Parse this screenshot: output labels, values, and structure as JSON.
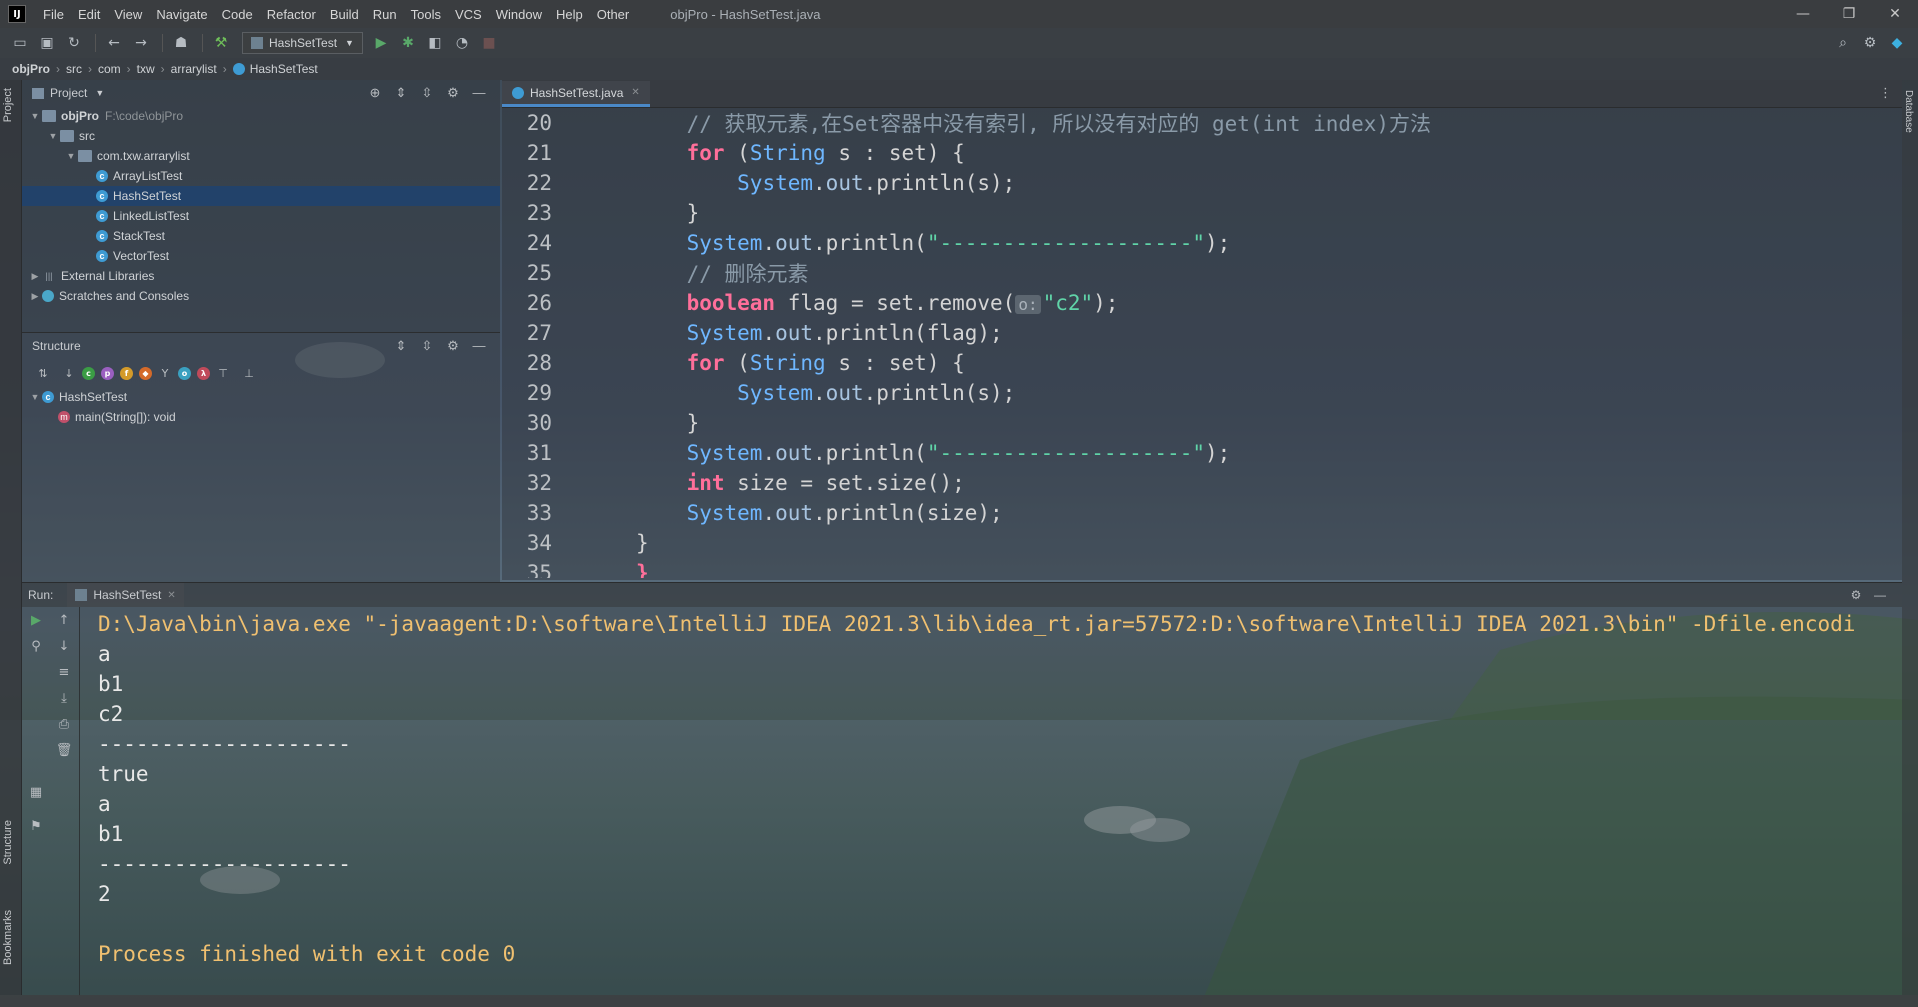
{
  "menubar": {
    "logo": "IJ",
    "items": [
      "File",
      "Edit",
      "View",
      "Navigate",
      "Code",
      "Refactor",
      "Build",
      "Run",
      "Tools",
      "VCS",
      "Window",
      "Help",
      "Other"
    ],
    "window_title": "objPro - HashSetTest.java",
    "minimize": "—",
    "restore": "❐",
    "close": "✕"
  },
  "toolbar": {
    "run_config": "HashSetTest"
  },
  "breadcrumb": [
    "objPro",
    "src",
    "com",
    "txw",
    "arrarylist",
    "HashSetTest"
  ],
  "left_stripe": {
    "project_tab": "Project",
    "structure_tab": "Structure",
    "bookmarks_tab": "Bookmarks"
  },
  "right_stripe": {
    "database_tab": "Database"
  },
  "project_panel": {
    "title": "Project",
    "tree": [
      {
        "label": "objPro",
        "sub": "F:\\code\\objPro",
        "indent": 0,
        "arrow": "down",
        "icon": "folder-icon"
      },
      {
        "label": "src",
        "indent": 1,
        "arrow": "down",
        "icon": "folder-icon"
      },
      {
        "label": "com.txw.arrarylist",
        "indent": 2,
        "arrow": "down",
        "icon": "folder-icon"
      },
      {
        "label": "ArrayListTest",
        "indent": 3,
        "arrow": "",
        "icon": "class-icon"
      },
      {
        "label": "HashSetTest",
        "indent": 3,
        "arrow": "",
        "icon": "class-icon",
        "selected": true
      },
      {
        "label": "LinkedListTest",
        "indent": 3,
        "arrow": "",
        "icon": "class-icon"
      },
      {
        "label": "StackTest",
        "indent": 3,
        "arrow": "",
        "icon": "class-icon"
      },
      {
        "label": "VectorTest",
        "indent": 3,
        "arrow": "",
        "icon": "class-icon"
      },
      {
        "label": "External Libraries",
        "indent": 0,
        "arrow": "right",
        "icon": "library-icon"
      },
      {
        "label": "Scratches and Consoles",
        "indent": 0,
        "arrow": "right",
        "icon": "scratch-icon"
      }
    ]
  },
  "structure_panel": {
    "title": "Structure",
    "tree": [
      {
        "label": "HashSetTest",
        "indent": 0
      },
      {
        "label": "main(String[]): void",
        "indent": 1
      }
    ]
  },
  "editor": {
    "tab_label": "HashSetTest.java",
    "lines": [
      {
        "num": "20",
        "html": "<span class=\"cm\">    // 获取元素,在Set容器中没有索引, 所以没有对应的 get(int index)方法</span>"
      },
      {
        "num": "21",
        "html": "    <span class=\"kw\">for</span> (<span class=\"ty\">String</span> s : set) {"
      },
      {
        "num": "22",
        "html": "        <span class=\"ty\">System</span>.<span class=\"fd\">out</span>.println(s);"
      },
      {
        "num": "23",
        "html": "    }"
      },
      {
        "num": "24",
        "html": "    <span class=\"ty\">System</span>.<span class=\"fd\">out</span>.println(<span class=\"st\">\"--------------------\"</span>);"
      },
      {
        "num": "25",
        "html": "<span class=\"cm\">    // 删除元素</span>"
      },
      {
        "num": "26",
        "html": "    <span class=\"kw\">boolean</span> flag = set.remove(<span class=\"hint\">o:</span><span class=\"st\">\"c2\"</span>);"
      },
      {
        "num": "27",
        "html": "    <span class=\"ty\">System</span>.<span class=\"fd\">out</span>.println(flag);"
      },
      {
        "num": "28",
        "html": "    <span class=\"kw\">for</span> (<span class=\"ty\">String</span> s : set) {"
      },
      {
        "num": "29",
        "html": "        <span class=\"ty\">System</span>.<span class=\"fd\">out</span>.println(s);"
      },
      {
        "num": "30",
        "html": "    }"
      },
      {
        "num": "31",
        "html": "    <span class=\"ty\">System</span>.<span class=\"fd\">out</span>.println(<span class=\"st\">\"--------------------\"</span>);"
      },
      {
        "num": "32",
        "html": "    <span class=\"kw\">int</span> size = set.size();"
      },
      {
        "num": "33",
        "html": "    <span class=\"ty\">System</span>.<span class=\"fd\">out</span>.println(size);"
      },
      {
        "num": "34",
        "html": "}"
      },
      {
        "num": "35",
        "html": "<span class=\"kw\">}</span>"
      }
    ]
  },
  "run_panel": {
    "label": "Run:",
    "tab_label": "HashSetTest",
    "output": [
      {
        "text": "D:\\Java\\bin\\java.exe \"-javaagent:D:\\software\\IntelliJ IDEA 2021.3\\lib\\idea_rt.jar=57572:D:\\software\\IntelliJ IDEA 2021.3\\bin\" -Dfile.encodi",
        "kind": "cmd"
      },
      {
        "text": "a",
        "kind": "out"
      },
      {
        "text": "b1",
        "kind": "out"
      },
      {
        "text": "c2",
        "kind": "out"
      },
      {
        "text": "--------------------",
        "kind": "out"
      },
      {
        "text": "true",
        "kind": "out"
      },
      {
        "text": "a",
        "kind": "out"
      },
      {
        "text": "b1",
        "kind": "out"
      },
      {
        "text": "--------------------",
        "kind": "out"
      },
      {
        "text": "2",
        "kind": "out"
      },
      {
        "text": "",
        "kind": "out"
      },
      {
        "text": "Process finished with exit code 0",
        "kind": "exit"
      }
    ]
  },
  "colors": {
    "keyword": "#ff6f9a",
    "type": "#6fb7ff",
    "string": "#60d4a8",
    "comment": "#8a9aa8",
    "selection": "#21426b",
    "console_cmd": "#f0c070"
  }
}
